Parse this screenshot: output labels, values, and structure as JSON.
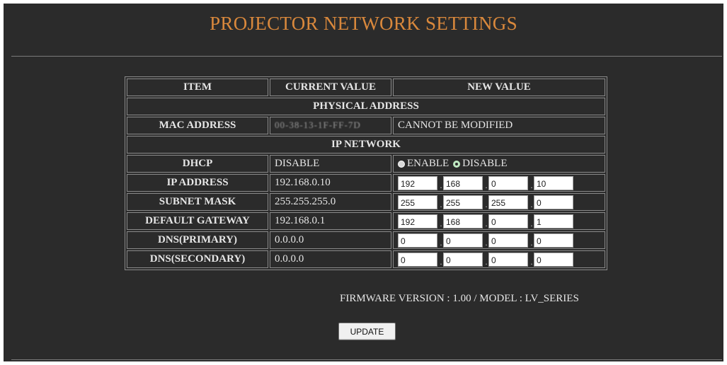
{
  "page": {
    "title": "PROJECTOR NETWORK SETTINGS"
  },
  "table": {
    "headers": [
      "ITEM",
      "CURRENT VALUE",
      "NEW VALUE"
    ],
    "section_physical": "PHYSICAL ADDRESS",
    "mac": {
      "label": "MAC ADDRESS",
      "current": "00-38-13-1F-FF-7D",
      "new": "CANNOT BE MODIFIED"
    },
    "section_ip": "IP NETWORK",
    "dhcp": {
      "label": "DHCP",
      "current": "DISABLE",
      "enable_label": "ENABLE",
      "disable_label": "DISABLE",
      "selected": "DISABLE"
    },
    "ip_address": {
      "label": "IP ADDRESS",
      "current": "192.168.0.10",
      "octets": [
        "192",
        "168",
        "0",
        "10"
      ]
    },
    "subnet_mask": {
      "label": "SUBNET MASK",
      "current": "255.255.255.0",
      "octets": [
        "255",
        "255",
        "255",
        "0"
      ]
    },
    "default_gateway": {
      "label": "DEFAULT GATEWAY",
      "current": "192.168.0.1",
      "octets": [
        "192",
        "168",
        "0",
        "1"
      ]
    },
    "dns_primary": {
      "label": "DNS(PRIMARY)",
      "current": "0.0.0.0",
      "octets": [
        "0",
        "0",
        "0",
        "0"
      ]
    },
    "dns_secondary": {
      "label": "DNS(SECONDARY)",
      "current": "0.0.0.0",
      "octets": [
        "0",
        "0",
        "0",
        "0"
      ]
    }
  },
  "footer": {
    "firmware": "FIRMWARE VERSION : 1.00 / MODEL : LV_SERIES"
  },
  "actions": {
    "update_label": "UPDATE"
  },
  "colors": {
    "background": "#2b2b2b",
    "title": "#d9883c",
    "text": "#e6e6e6"
  }
}
